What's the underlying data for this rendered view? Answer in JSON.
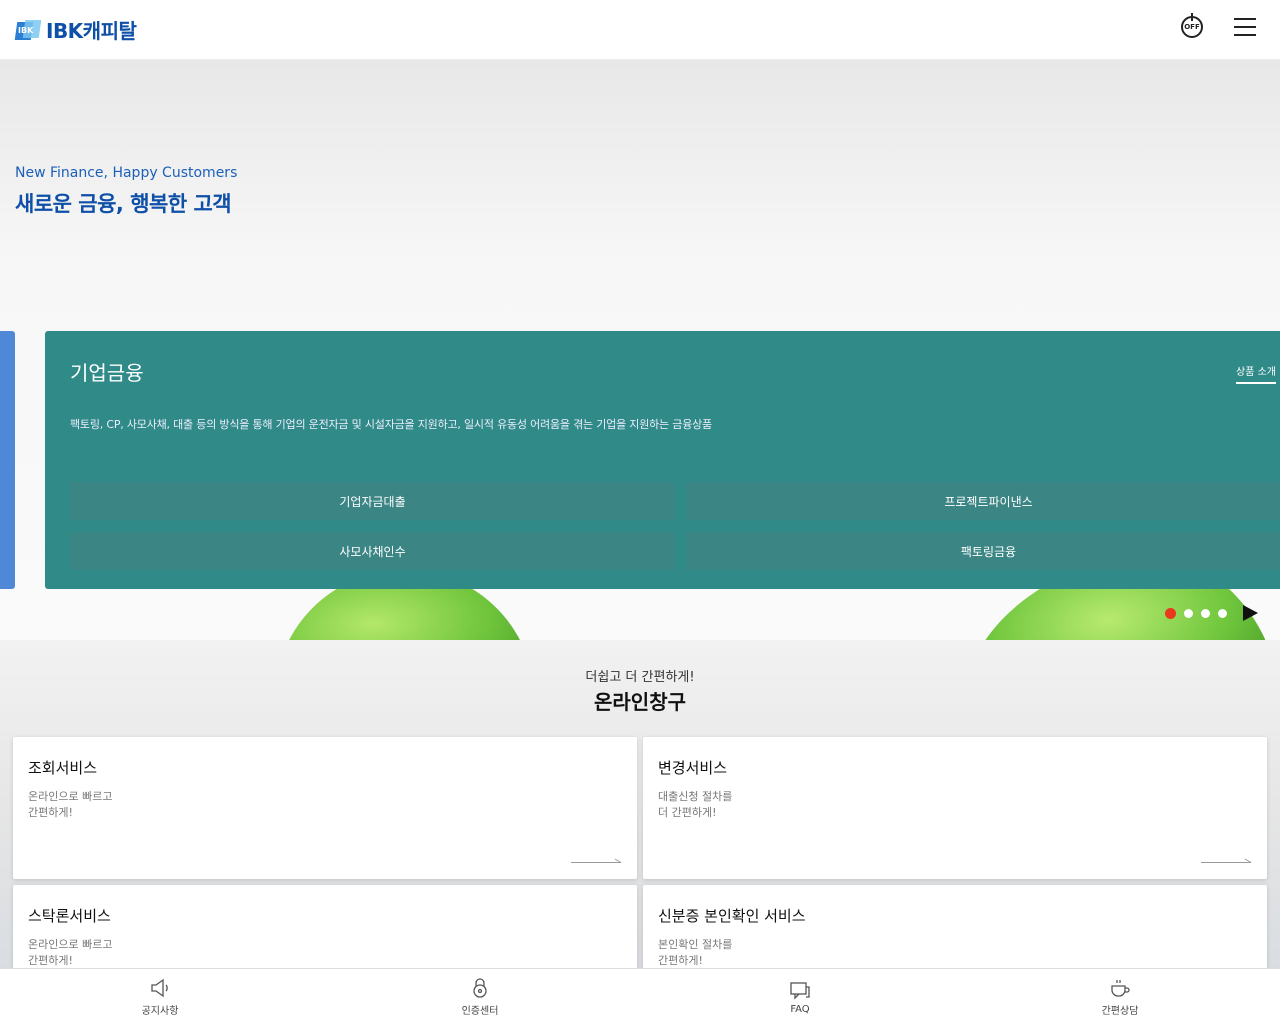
{
  "header": {
    "logo_mark": "IBK",
    "logo_text": "IBK캐피탈",
    "off_label": "OFF"
  },
  "hero": {
    "subtitle": "New Finance, Happy Customers",
    "title": "새로운 금융, 행복한 고객"
  },
  "panel": {
    "title": "기업금융",
    "link": "상품 소개",
    "description": "팩토링, CP, 사모사채, 대출 등의 방식을 통해 기업의 운전자금 및 시설자금을 지원하고, 일시적 유동성 어려움을 겪는 기업을 지원하는 금융상품",
    "buttons": [
      "기업자금대출",
      "프로젝트파이낸스",
      "사모사채인수",
      "팩토링금융"
    ]
  },
  "online": {
    "subtitle": "더쉽고 더 간편하게!",
    "title": "온라인창구",
    "services": [
      {
        "title": "조회서비스",
        "desc": "온라인으로 빠르고\n간편하게!"
      },
      {
        "title": "변경서비스",
        "desc": "대출신청 절차를\n더 간편하게!"
      },
      {
        "title": "스탁론서비스",
        "desc": "온라인으로 빠르고\n간편하게!"
      },
      {
        "title": "신분증 본인확인 서비스",
        "desc": "본인확인 절차를\n간편하게!"
      }
    ]
  },
  "bottom_nav": [
    {
      "label": "공지사항",
      "icon": "megaphone-icon"
    },
    {
      "label": "인증센터",
      "icon": "lock-icon"
    },
    {
      "label": "FAQ",
      "icon": "faq-chat-icon"
    },
    {
      "label": "간편상담",
      "icon": "coffee-cup-icon"
    }
  ],
  "colors": {
    "brand": "#0e4fa8",
    "panel": "#2f8a88",
    "side_bar": "#4e88d6",
    "active_dot": "#e8381e"
  }
}
